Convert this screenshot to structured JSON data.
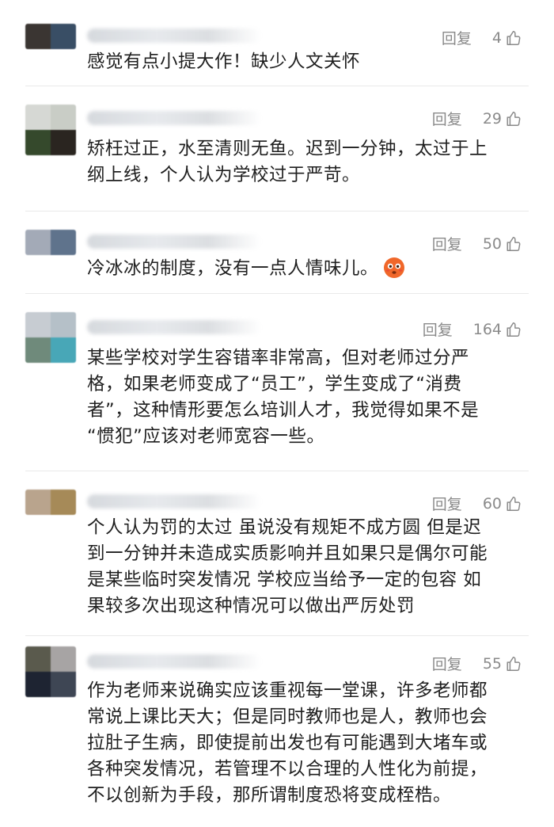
{
  "comments": [
    {
      "avatar_colors": [
        "#3a3532",
        "#394e65"
      ],
      "reply_label": "回复",
      "likes": "4",
      "text": "感觉有点小提大作！缺少人文关怀"
    },
    {
      "avatar_colors": [
        "#d6d8d4",
        "#c9cdc6",
        "#35492c",
        "#2a2520"
      ],
      "reply_label": "回复",
      "likes": "29",
      "text": "矫枉过正，水至清则无鱼。迟到一分钟，太过于上\n纲上线，个人认为学校过于严苛。"
    },
    {
      "avatar_colors": [
        "#a3aab7",
        "#5f738c"
      ],
      "reply_label": "回复",
      "likes": "50",
      "text": "冷冰冰的制度，没有一点人情味儿。",
      "emoji": "flushed-face-emoji"
    },
    {
      "avatar_colors": [
        "#c7ccd2",
        "#b5c0c8",
        "#6f8a7b",
        "#48a7b7"
      ],
      "reply_label": "回复",
      "likes": "164",
      "text": "某些学校对学生容错率非常高，但对老师过分严\n格，如果老师变成了“员工”，学生变成了“消费\n者”，这种情形要怎么培训人才，我觉得如果不是\n“惯犯”应该对老师宽容一些。"
    },
    {
      "avatar_colors": [
        "#b9a48d",
        "#a68a58"
      ],
      "reply_label": "回复",
      "likes": "60",
      "text": "个人认为罚的太过 虽说没有规矩不成方圆 但是迟\n到一分钟并未造成实质影响并且如果只是偶尔可能\n是某些临时突发情况 学校应当给予一定的包容 如\n果较多次出现这种情况可以做出严厉处罚"
    },
    {
      "avatar_colors": [
        "#5a5a4d",
        "#a7a4a4",
        "#1e2432",
        "#3e4654"
      ],
      "reply_label": "回复",
      "likes": "55",
      "text": "作为老师来说确实应该重视每一堂课，许多老师都\n常说上课比天大；但是同时教师也是人，教师也会\n拉肚子生病，即使提前出发也有可能遇到大堵车或\n各种突发情况，若管理不以合理的人性化为前提，\n不以创新为手段，那所谓制度恐将变成桎梏。"
    }
  ]
}
